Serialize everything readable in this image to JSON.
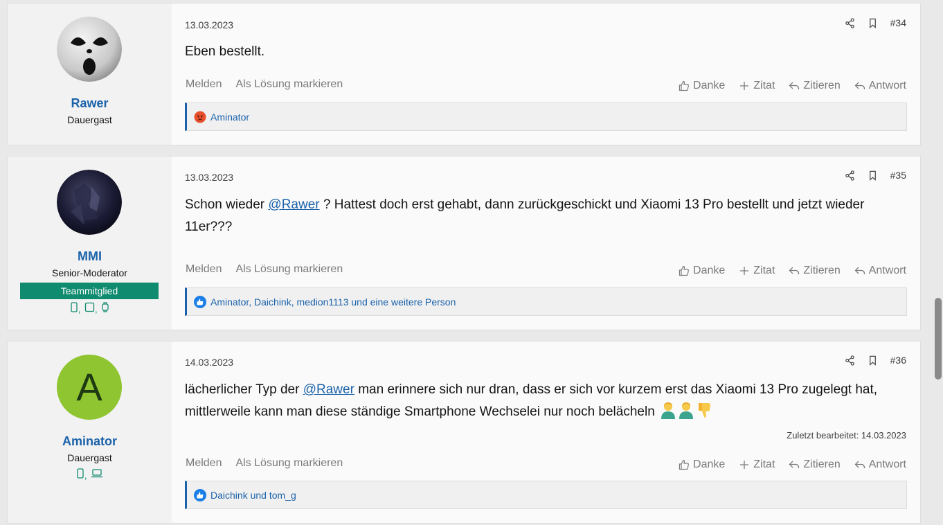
{
  "actions": {
    "report": "Melden",
    "mark_solution": "Als Lösung markieren",
    "like": "Danke",
    "quote_add": "Zitat",
    "quote": "Zitieren",
    "reply": "Antwort"
  },
  "posts": [
    {
      "date": "13.03.2023",
      "number": "#34",
      "user": {
        "name": "Rawer",
        "title": "Dauergast"
      },
      "body": "Eben bestellt.",
      "reactions": "Aminator"
    },
    {
      "date": "13.03.2023",
      "number": "#35",
      "user": {
        "name": "MMI",
        "title": "Senior-Moderator",
        "banner": "Teammitglied"
      },
      "body_pre": "Schon wieder ",
      "mention": "@Rawer",
      "body_post": " ? Hattest doch erst gehabt, dann zurückgeschickt und Xiaomi 13 Pro bestellt und jetzt wieder 11er???",
      "reactions": "Aminator, Daichink, medion1113 und eine weitere Person"
    },
    {
      "date": "14.03.2023",
      "number": "#36",
      "user": {
        "name": "Aminator",
        "title": "Dauergast",
        "avatar_letter": "A"
      },
      "body_pre": "lächerlicher Typ der ",
      "mention": "@Rawer",
      "body_post": " man erinnere sich nur dran, dass er sich vor kurzem erst das Xiaomi 13 Pro zugelegt hat, mittlerweile kann man diese ständige Smartphone Wechselei nur noch belächeln",
      "edited": "Zuletzt bearbeitet: 14.03.2023",
      "reactions": "Daichink und tom_g"
    }
  ],
  "colors": {
    "accent": "#1a62aa",
    "team_banner": "#0f8b6f",
    "avatar_a_bg": "#8fc531"
  },
  "icons": [
    "share-icon",
    "bookmark-icon",
    "thumbs-up-icon",
    "plus-icon",
    "reply-icon",
    "angry-emoji-icon",
    "like-reaction-icon",
    "phone-icon",
    "tablet-icon",
    "watch-icon",
    "laptop-icon"
  ]
}
